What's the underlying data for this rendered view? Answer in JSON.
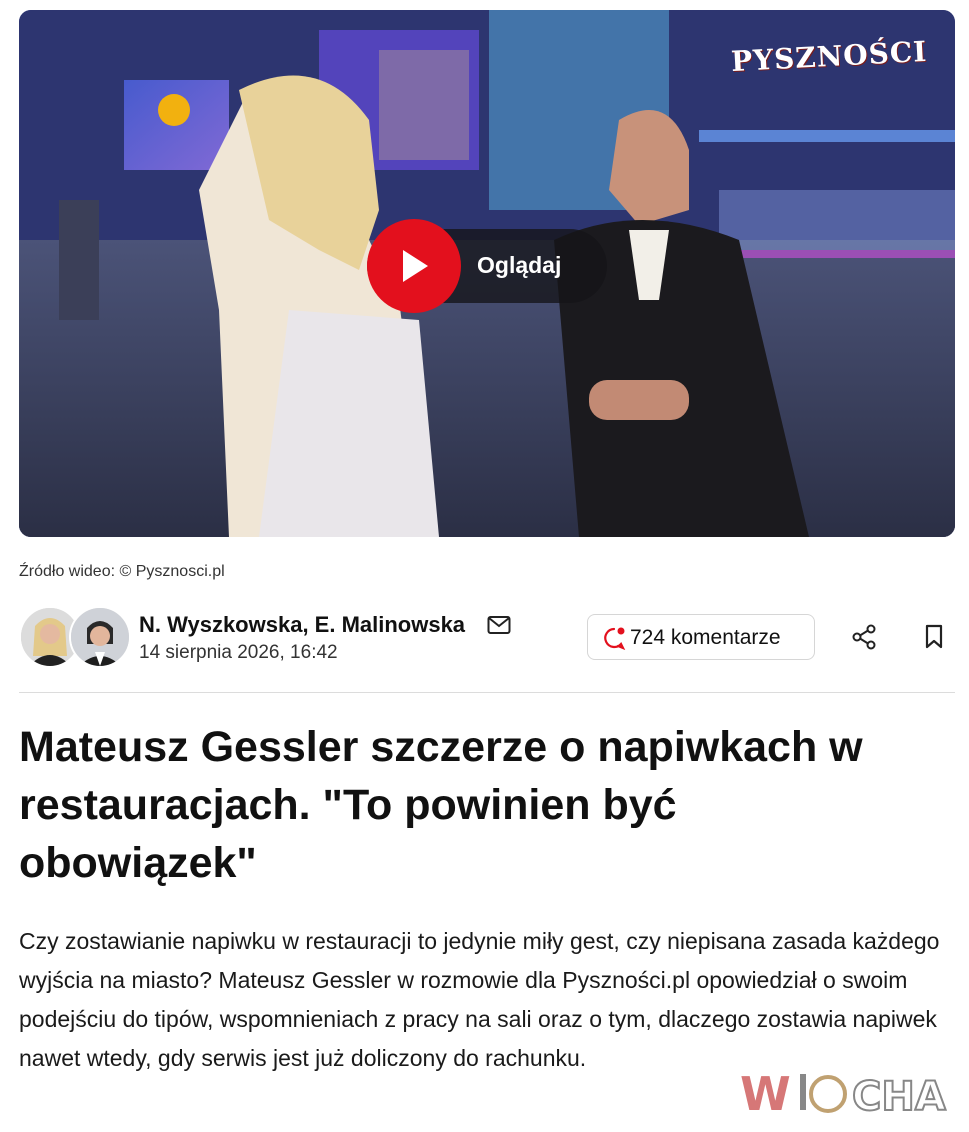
{
  "video": {
    "play_label": "Oglądaj",
    "brand": "PYSZNOŚCI",
    "accent": "#e3101d"
  },
  "source": "Źródło wideo: © Pysznosci.pl",
  "article": {
    "authors": "N. Wyszkowska, E. Malinowska",
    "date": "14 sierpnia 2026, 16:42",
    "comments": "724 komentarze",
    "title": "Mateusz Gessler szczerze o napiwkach w restauracjach. \"To powinien być obowiązek\"",
    "lead": "Czy zostawianie napiwku w restauracji to jedynie miły gest, czy niepisana zasada każdego wyjścia na miasto? Mateusz Gessler w rozmowie dla Pyszności.pl opowiedział o swoim podejściu do tipów, wspomnieniach z pracy na sali oraz o tym, dlaczego zostawia napiwek nawet wtedy, gdy serwis jest już doliczony do rachunku."
  },
  "icons": {
    "mail": "mail-icon",
    "comments": "comment-icon",
    "share": "share-icon",
    "bookmark": "bookmark-icon"
  }
}
